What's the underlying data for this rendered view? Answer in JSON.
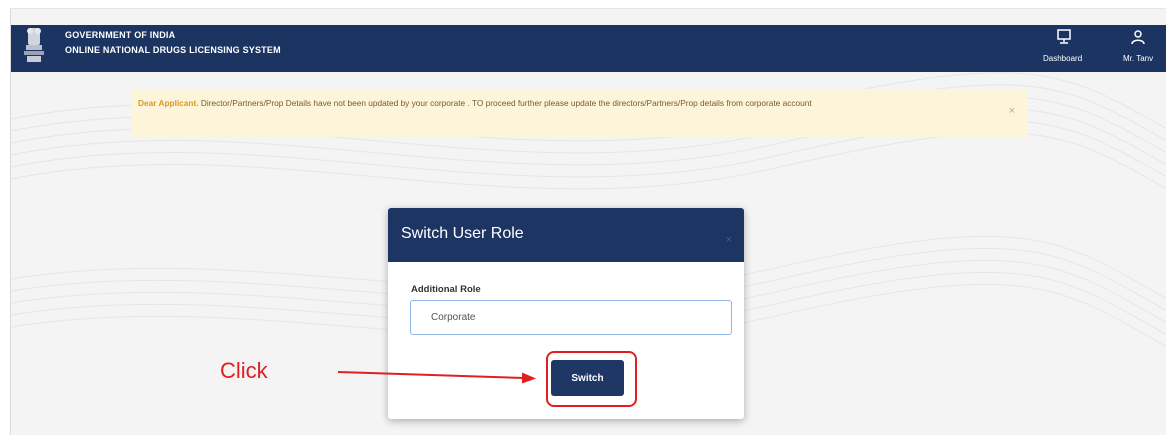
{
  "header": {
    "title": "GOVERNMENT OF INDIA",
    "subtitle": "ONLINE NATIONAL DRUGS LICENSING SYSTEM",
    "nav": {
      "dashboard_label": "Dashboard",
      "user_label": "Mr. Tanv"
    }
  },
  "alert": {
    "greeting": "Dear Applicant.",
    "message": " Director/Partners/Prop Details have not been updated by your corporate . TO proceed further please update the directors/Partners/Prop details from corporate account",
    "close_glyph": "×"
  },
  "modal": {
    "title": "Switch User Role",
    "close_glyph": "×",
    "field_label": "Additional Role",
    "selected_role": "Corporate",
    "switch_label": "Switch"
  },
  "annotation": {
    "label": "Click",
    "color": "#e02020"
  },
  "colors": {
    "navbar": "#1c3462",
    "modal_header": "#1d3563",
    "button": "#1f3764",
    "alert_bg": "#fcf5d9",
    "alert_accent": "#d69a2a"
  }
}
